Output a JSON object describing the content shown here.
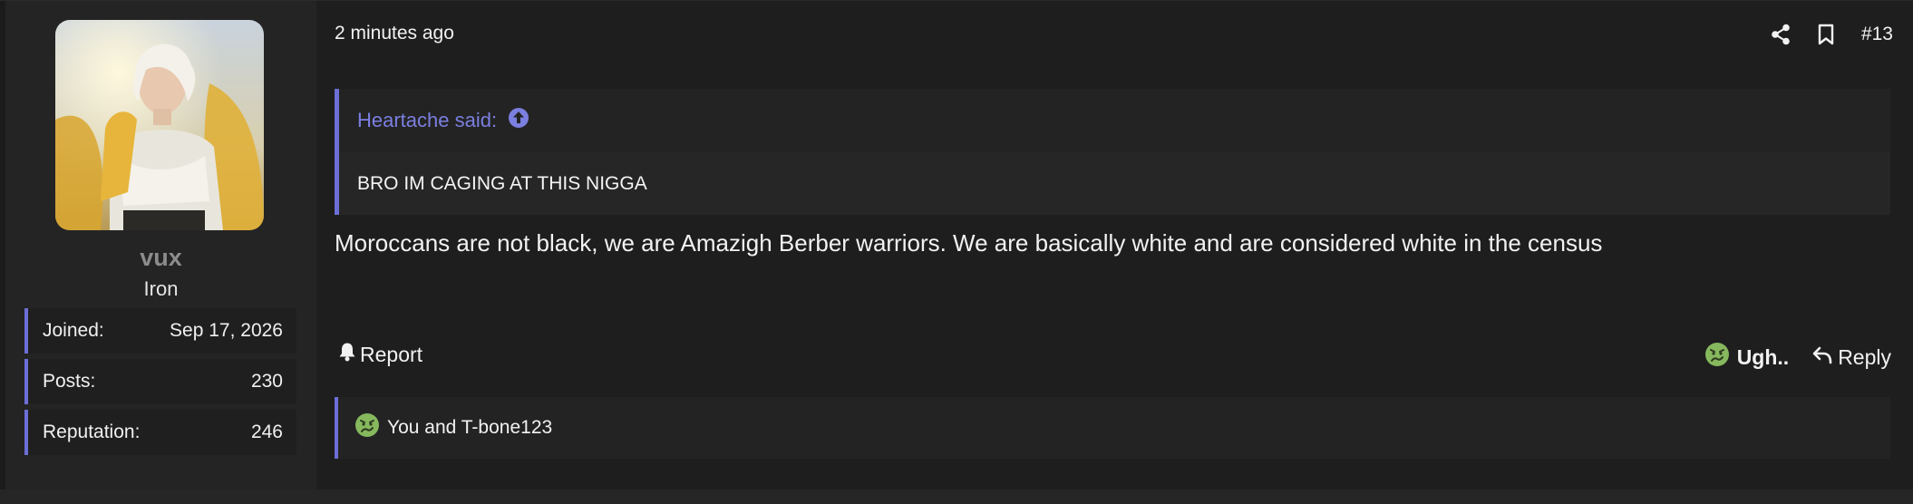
{
  "colors": {
    "accent": "#6c6fd6",
    "quote_link": "#7b7fe0",
    "emoji_green": "#86b85e"
  },
  "author": {
    "username": "vux",
    "title": "Iron",
    "stats": [
      {
        "label": "Joined:",
        "value": "Sep 17, 2026"
      },
      {
        "label": "Posts:",
        "value": "230"
      },
      {
        "label": "Reputation:",
        "value": "246"
      }
    ]
  },
  "post": {
    "timestamp": "2 minutes ago",
    "number": "#13",
    "share_icon": "share-icon",
    "bookmark_icon": "bookmark-icon",
    "quote": {
      "author_line": "Heartache said:",
      "jump_icon": "arrow-up-circle-icon",
      "text": "BRO IM CAGING AT THIS NIGGA"
    },
    "message": "Moroccans are not black, we are Amazigh Berber warriors. We are basically white and are considered white in the census"
  },
  "actions": {
    "report_label": "Report",
    "report_icon": "bell-icon",
    "reaction_label": "Ugh..",
    "reaction_icon": "sick-face-icon",
    "reply_label": "Reply",
    "reply_icon": "reply-arrow-icon"
  },
  "reactions": {
    "icon": "sick-face-icon",
    "text": "You and T-bone123"
  }
}
